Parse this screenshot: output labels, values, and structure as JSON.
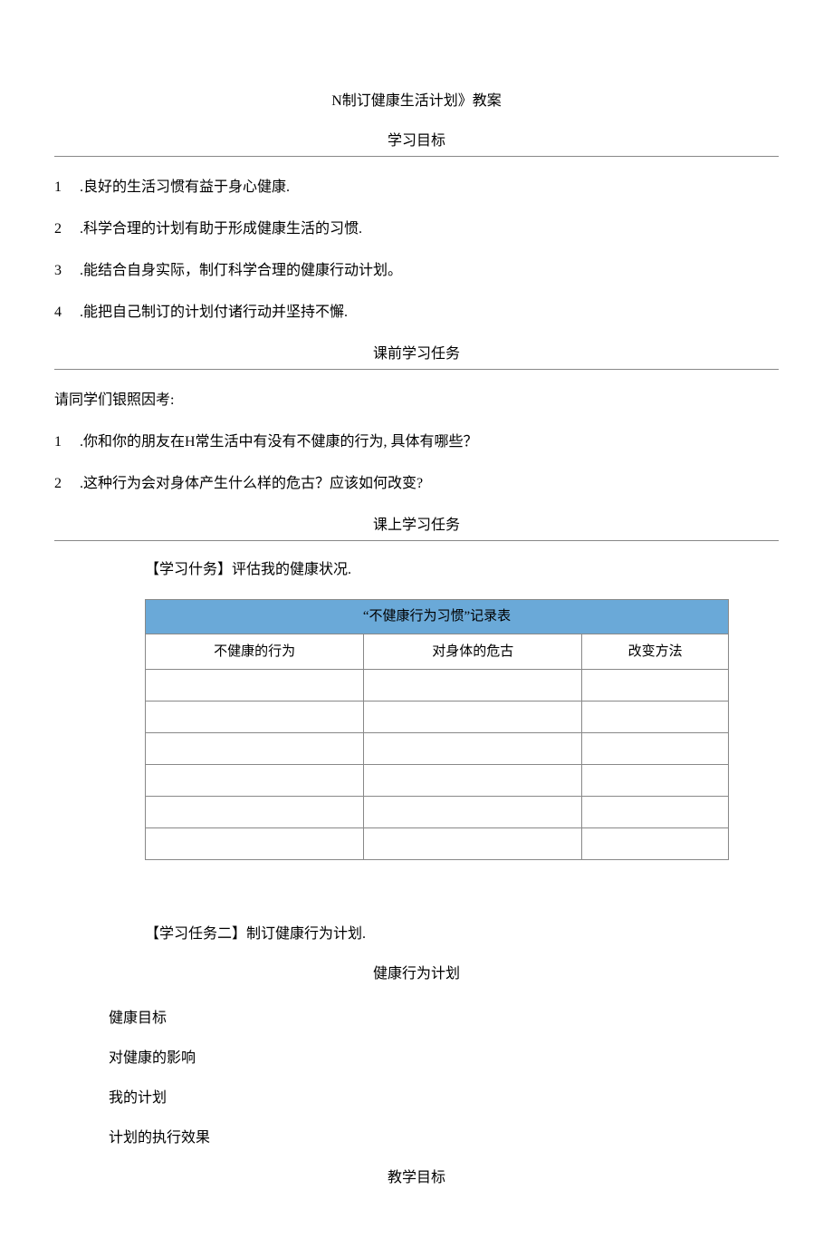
{
  "title": "N制订健康生活计划》教案",
  "sections": {
    "learning_goal": "学习目标",
    "pre_task": "课前学习任务",
    "in_class_task": "课上学习任务",
    "teaching_goal": "教学目标"
  },
  "goals": [
    ".良好的生活习惯有益于身心健康.",
    ".科学合理的计划有助于形成健康生活的习惯.",
    ".能结合自身实际，制仃科学合理的健康行动计划。",
    ".能把自己制订的计划付诸行动并坚持不懈."
  ],
  "pre_task_intro": "请同学们银照因考:",
  "pre_task_items": [
    ".你和你的朋友在H常生活中有没有不健康的行为, 具体有哪些？",
    ".这种行为会对身体产生什么样的危古？应该如何改变?"
  ],
  "task1_label": "【学习什务】评估我的健康状况.",
  "table": {
    "title": "“不健康行为习惯”记录表",
    "headers": [
      "不健康的行为",
      "对身体的危古",
      "改变方法"
    ],
    "rows": [
      [
        "",
        "",
        ""
      ],
      [
        "",
        "",
        ""
      ],
      [
        "",
        "",
        ""
      ],
      [
        "",
        "",
        ""
      ],
      [
        "",
        "",
        ""
      ],
      [
        "",
        "",
        ""
      ]
    ]
  },
  "task2_label": "【学习任务二】制订健康行为计划.",
  "plan": {
    "title": "健康行为计划",
    "items": [
      "健康目标",
      "对健康的影响",
      "我的计划",
      "计划的执行效果"
    ]
  },
  "numbers": [
    "1",
    "2",
    "3",
    "4"
  ]
}
